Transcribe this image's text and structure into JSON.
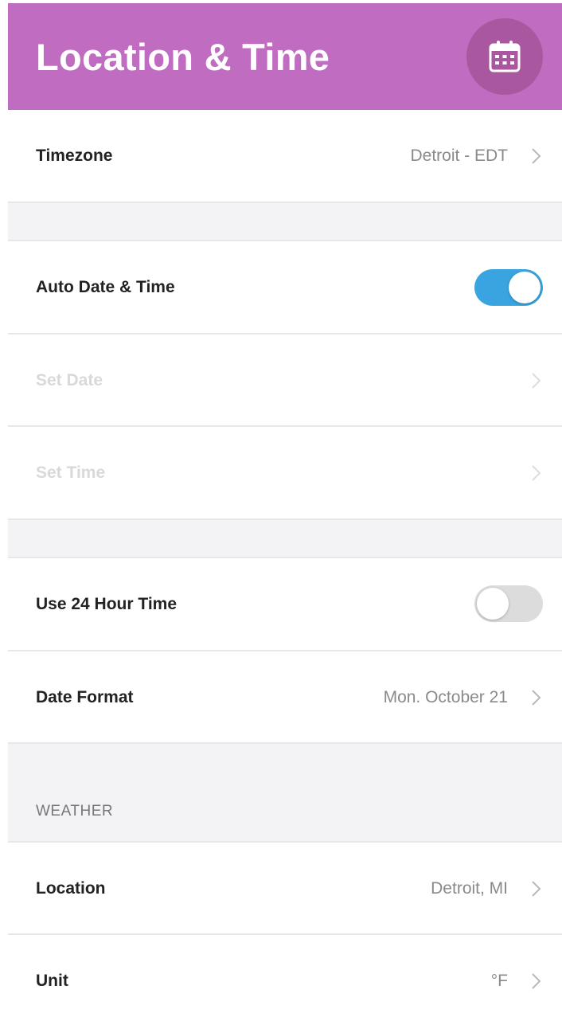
{
  "header": {
    "title": "Location & Time",
    "action_icon": "calendar-icon"
  },
  "rows": {
    "timezone": {
      "label": "Timezone",
      "value": "Detroit - EDT"
    },
    "auto_date_time": {
      "label": "Auto Date & Time",
      "on": true
    },
    "set_date": {
      "label": "Set Date"
    },
    "set_time": {
      "label": "Set Time"
    },
    "use_24_hour": {
      "label": "Use 24 Hour Time",
      "on": false
    },
    "date_format": {
      "label": "Date Format",
      "value": "Mon. October 21"
    }
  },
  "weather": {
    "section_label": "WEATHER",
    "location": {
      "label": "Location",
      "value": "Detroit, MI"
    },
    "unit": {
      "label": "Unit",
      "value": "°F"
    }
  },
  "colors": {
    "header_bg": "#c06cc0",
    "icon_circle": "#a9579f",
    "toggle_on": "#3aa4e0",
    "toggle_off": "#dcdcdc"
  }
}
